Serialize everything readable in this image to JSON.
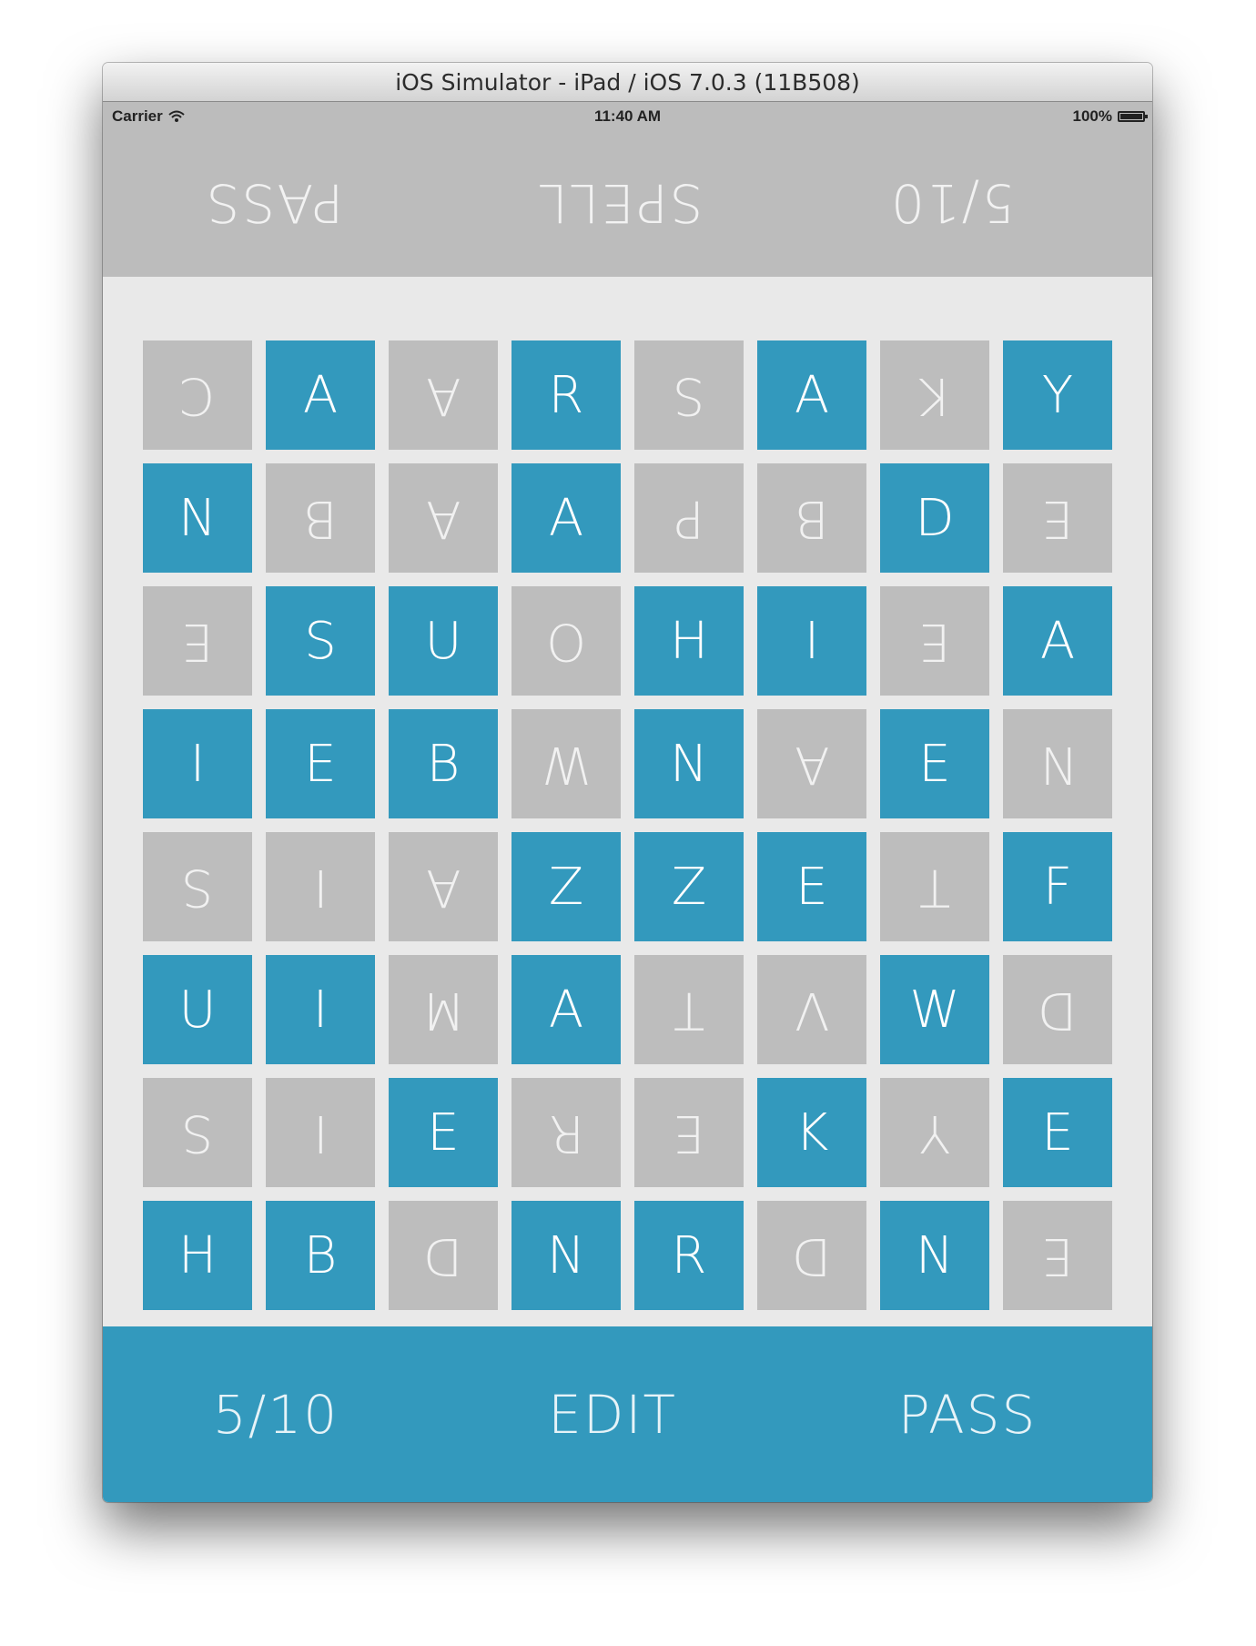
{
  "window": {
    "title": "iOS Simulator - iPad / iOS 7.0.3 (11B508)"
  },
  "status_bar": {
    "carrier": "Carrier",
    "time": "11:40 AM",
    "battery": "100%"
  },
  "top_bar": {
    "left_label": "5/10",
    "center_label": "SPELL",
    "right_label": "PASS"
  },
  "bottom_bar": {
    "left_label": "5/10",
    "center_label": "EDIT",
    "right_label": "PASS"
  },
  "colors": {
    "blue": "#3399bd",
    "gray": "#bdbdbd",
    "board_bg": "#e9e9e9",
    "top_bar_bg": "#bcbcbc"
  },
  "grid": {
    "letters": [
      [
        "C",
        "A",
        "A",
        "R",
        "S",
        "A",
        "K",
        "Y"
      ],
      [
        "N",
        "B",
        "A",
        "A",
        "P",
        "B",
        "D",
        "E"
      ],
      [
        "E",
        "S",
        "U",
        "O",
        "H",
        "I",
        "E",
        "A"
      ],
      [
        "I",
        "E",
        "B",
        "W",
        "N",
        "A",
        "E",
        "N"
      ],
      [
        "S",
        "I",
        "A",
        "Z",
        "Z",
        "E",
        "T",
        "F"
      ],
      [
        "U",
        "I",
        "M",
        "A",
        "T",
        "V",
        "W",
        "D"
      ],
      [
        "S",
        "I",
        "E",
        "R",
        "E",
        "K",
        "Y",
        "E"
      ],
      [
        "H",
        "B",
        "D",
        "N",
        "R",
        "D",
        "N",
        "E"
      ]
    ],
    "owners": [
      [
        "gray",
        "blue",
        "gray",
        "blue",
        "gray",
        "blue",
        "gray",
        "blue"
      ],
      [
        "blue",
        "gray",
        "gray",
        "blue",
        "gray",
        "gray",
        "blue",
        "gray"
      ],
      [
        "gray",
        "blue",
        "blue",
        "gray",
        "blue",
        "blue",
        "gray",
        "blue"
      ],
      [
        "blue",
        "blue",
        "blue",
        "gray",
        "blue",
        "gray",
        "blue",
        "gray"
      ],
      [
        "gray",
        "gray",
        "gray",
        "blue",
        "blue",
        "blue",
        "gray",
        "blue"
      ],
      [
        "blue",
        "blue",
        "gray",
        "blue",
        "gray",
        "gray",
        "blue",
        "gray"
      ],
      [
        "gray",
        "gray",
        "blue",
        "gray",
        "gray",
        "blue",
        "gray",
        "blue"
      ],
      [
        "blue",
        "blue",
        "gray",
        "blue",
        "blue",
        "gray",
        "blue",
        "gray"
      ]
    ]
  }
}
